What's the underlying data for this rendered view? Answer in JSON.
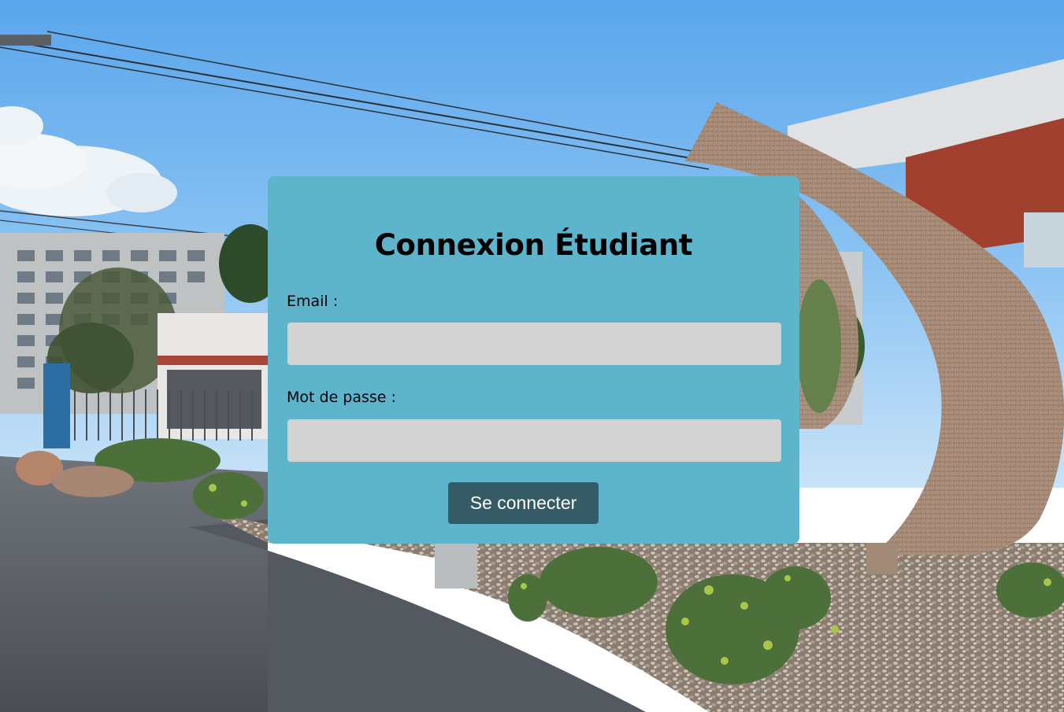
{
  "login": {
    "title": "Connexion Étudiant",
    "email_label": "Email :",
    "email_value": "",
    "password_label": "Mot de passe :",
    "password_value": "",
    "submit_label": "Se connecter"
  },
  "colors": {
    "card_background": "#5db4cb",
    "input_background": "#d3d3d3",
    "button_background": "#355c66",
    "button_text": "#ffffff"
  },
  "background": {
    "description_icon": "campus-photo-background"
  }
}
